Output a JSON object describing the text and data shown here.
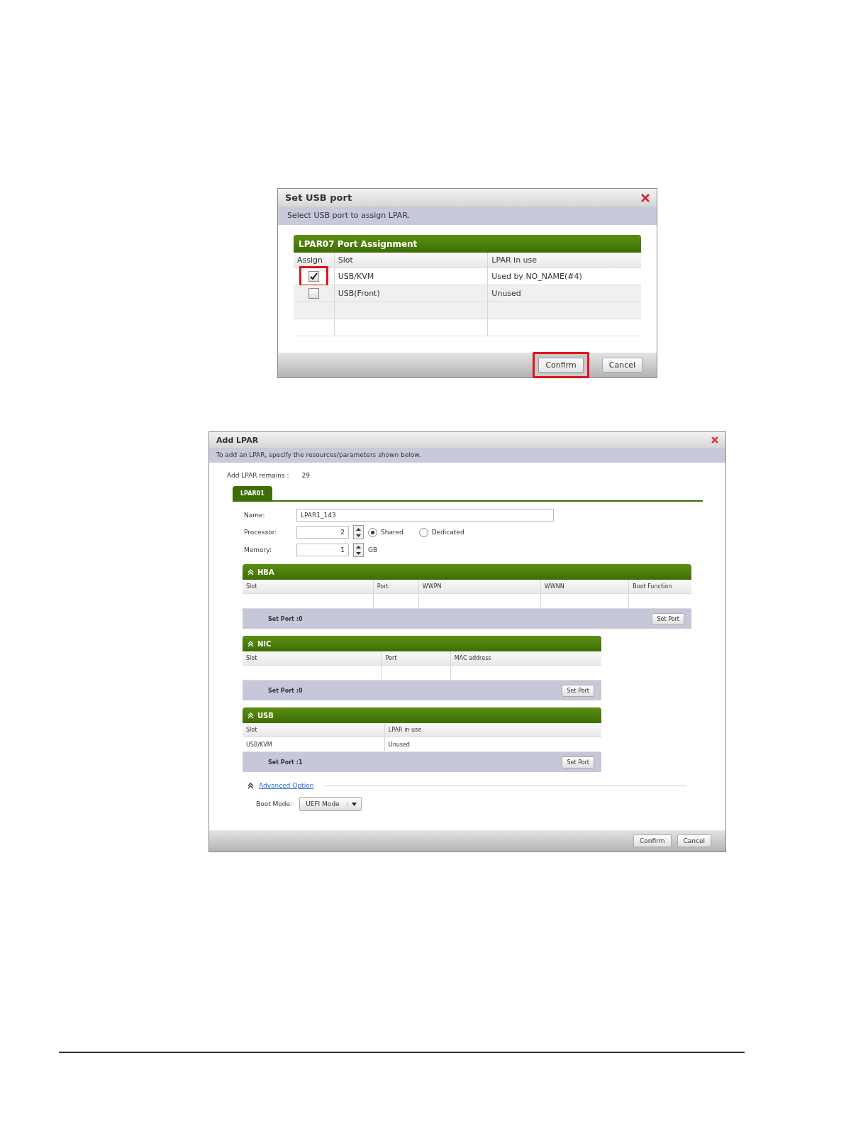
{
  "set_usb_dialog": {
    "title": "Set USB port",
    "instruction": "Select USB port to assign LPAR.",
    "table": {
      "title": "LPAR07 Port Assignment",
      "columns": [
        "Assign",
        "Slot",
        "LPAR in use"
      ],
      "rows": [
        {
          "checked": true,
          "highlighted": true,
          "slot": "USB/KVM",
          "lpar_in_use": "Used by NO_NAME(#4)"
        },
        {
          "checked": false,
          "highlighted": false,
          "slot": "USB(Front)",
          "lpar_in_use": "Unused"
        }
      ]
    },
    "buttons": [
      {
        "label": "Confirm",
        "highlighted": true
      },
      {
        "label": "Cancel",
        "highlighted": false
      }
    ]
  },
  "add_lpar_dialog": {
    "title": "Add LPAR",
    "instruction": "To add an LPAR, specify the resources/parameters shown below.",
    "remains_label": "Add LPAR remains :",
    "remains_value": "29",
    "tabs": [
      {
        "label": "LPAR01",
        "selected": true
      }
    ],
    "name": {
      "label": "Name:",
      "value": "LPAR1_143"
    },
    "processor": {
      "label": "Processor:",
      "value": "2",
      "options": [
        {
          "label": "Shared",
          "selected": true
        },
        {
          "label": "Dedicated",
          "selected": false
        }
      ]
    },
    "memory": {
      "label": "Memory:",
      "value": "1",
      "unit": "GB"
    },
    "sections": [
      {
        "kind": "hba",
        "title": "HBA",
        "expanded": true,
        "columns": [
          "Slot",
          "Port",
          "WWPN",
          "WWNN",
          "Boot Function"
        ],
        "footer": "Set Port :0",
        "button": "Set Port"
      },
      {
        "kind": "nic",
        "title": "NIC",
        "expanded": true,
        "columns": [
          "Slot",
          "Port",
          "MAC address"
        ],
        "footer": "Set Port :0",
        "button": "Set Port"
      },
      {
        "kind": "usb",
        "title": "USB",
        "expanded": true,
        "columns": [
          "Slot",
          "LPAR in use"
        ],
        "rows": [
          [
            "USB/KVM",
            "Unused"
          ]
        ],
        "footer": "Set Port :1",
        "button": "Set Port"
      }
    ],
    "advanced": {
      "link": "Advanced Option",
      "expanded": true,
      "boot_mode_label": "Boot Mode:",
      "boot_mode_value": "UEFI Mode"
    },
    "buttons": [
      {
        "label": "Confirm"
      },
      {
        "label": "Cancel"
      }
    ]
  }
}
